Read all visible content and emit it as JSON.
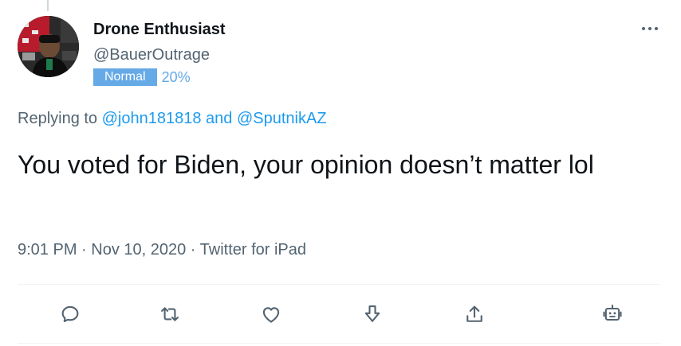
{
  "user": {
    "display_name": "Drone Enthusiast",
    "handle": "@BauerOutrage",
    "badge_label": "Normal",
    "badge_percent": "20%"
  },
  "reply": {
    "prefix": "Replying to ",
    "mention_1": "@john181818",
    "conjunction": " and ",
    "mention_2": "@SputnikAZ"
  },
  "tweet": {
    "text": "You voted for Biden, your opinion doesn’t matter lol",
    "meta": "9:01 PM · Nov 10, 2020 · Twitter for iPad"
  },
  "actions": [
    {
      "icon": "reply-icon"
    },
    {
      "icon": "retweet-icon"
    },
    {
      "icon": "like-icon"
    },
    {
      "icon": "download-icon"
    },
    {
      "icon": "share-icon"
    },
    {
      "icon": "bot-icon"
    }
  ],
  "colors": {
    "accent": "#1d9bf0",
    "badge": "#65a9e6",
    "secondary_text": "#536471",
    "icon": "#536471"
  }
}
